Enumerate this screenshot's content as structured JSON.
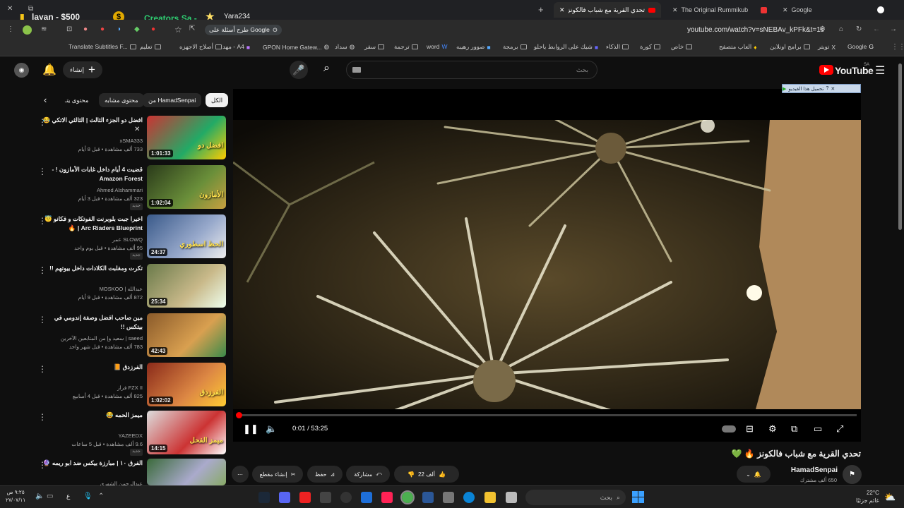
{
  "browser": {
    "tabs": [
      {
        "title": "تحدي القرية مع شباب فالكونز"
      },
      {
        "title": "The Original Rummikub"
      },
      {
        "title": "Google"
      }
    ],
    "url": "youtube.com/watch?v=sNEBAv_kPFk&t=1s",
    "google_ask_chip": "طرح أسئلة على Google",
    "bookmarks": [
      "Google",
      "تويتر",
      "برامج اونلاين",
      "العاب متصفح",
      "خاص",
      "كورة",
      "الذكاء",
      "شيك على الروابط ياحلو",
      "برمجة",
      "صوور رهيبه",
      "word",
      "ترجمة",
      "سفر",
      "سداد",
      "GPON Home Gatew...",
      "مهد - A4",
      "أصلاح الاجهزه",
      "تعليم",
      "Translate Subtitles F..."
    ]
  },
  "overlay": {
    "left_text": "layan - $500",
    "center_text": "Creators Sa -",
    "right_text": "Yara234"
  },
  "header": {
    "logo": "YouTube",
    "region": "SA",
    "search_placeholder": "بحث",
    "create_label": "إنشاء"
  },
  "chips": {
    "all": "الكل",
    "from_channel": "من HamadSenpai",
    "similar": "محتوى مشابه",
    "more": "محتوى يتـ"
  },
  "recommendations": [
    {
      "title": "افضل دو الجزء الثالث | الثالثي الاتكي 😂",
      "channel": "xSMA333",
      "meta": "733 ألف مشاهدة • قبل 8 أيام",
      "duration": "1:01:33",
      "new": "",
      "thumb_text": "افضل دو"
    },
    {
      "title": "قضيت 4 أيام داخل غابات الأمازون ! - Amazon Forest",
      "channel": "Ahmed Alshammari",
      "meta": "323 ألف مشاهدة • قبل 3 أيام",
      "duration": "1:02:04",
      "new": "جديد",
      "thumb_text": "الأمازون"
    },
    {
      "title": "اخيرا جبت بلوبرنت الفوتكات و فكانو 😇 Arc Riaders Blueprint | 🔥",
      "channel": "SLOWQ عمر",
      "meta": "95 ألف مشاهدة • قبل يوم واحد",
      "duration": "24:37",
      "new": "جديد",
      "thumb_text": "الحظ اسطوري"
    },
    {
      "title": "تكرت ومقلبت الكلادات داخل بيوتهم !!",
      "channel": "عبدالله | MOSKOO",
      "meta": "872 ألف مشاهدة • قبل 9 أيام",
      "duration": "25:34",
      "new": "",
      "thumb_text": ""
    },
    {
      "title": "مين صاحب افضل وصفة إندومي في بيتكس !!",
      "channel": "saeed | سعيد وإ من المتابعين الآخرين",
      "meta": "783 ألف مشاهدة • قبل شهر واحد",
      "duration": "42:43",
      "new": "",
      "thumb_text": ""
    },
    {
      "title": "الفرزدق 📙",
      "channel": "FZX II فراز",
      "meta": "825 ألف مشاهدة • قبل 4 أسابيع",
      "duration": "1:02:02",
      "new": "",
      "thumb_text": "الفرزدق"
    },
    {
      "title": "ميمز الحمه 😂",
      "channel": "YAZEEDX",
      "meta": "9.6 ألف مشاهدة • قبل 5 ساعات",
      "duration": "14:15",
      "new": "جديد",
      "thumb_text": "ميمز الفحل"
    },
    {
      "title": "الفرق ١٠ | مبارزة بيكس ضد ابو ريمه 🔮",
      "channel": "عبدالرحمن الشهري",
      "meta": "",
      "duration": "",
      "new": "",
      "thumb_text": ""
    }
  ],
  "player": {
    "time": "0:01 / 53:25",
    "progress": 0.0003,
    "download_bar": "تحميل هذا الفيديو"
  },
  "video": {
    "title": "تحدي القرية مع شباب فالكونز 🔥 💚",
    "channel": "HamadSenpai",
    "subscribers": "650 ألف مشترك",
    "likes": "22 ألف",
    "share": "مشاركة",
    "save": "حفظ",
    "clip": "إنشاء مقطع"
  },
  "taskbar": {
    "weather_temp": "22°C",
    "weather_desc": "غائم جزئيًا",
    "search": "بحث",
    "time": "٩:٢٥ ص",
    "date": "٢٧/٠٧/١١",
    "lang": "ع"
  },
  "colors": {
    "accent": "#ff0000",
    "bg": "#0f0f0f",
    "chip": "#272727"
  }
}
